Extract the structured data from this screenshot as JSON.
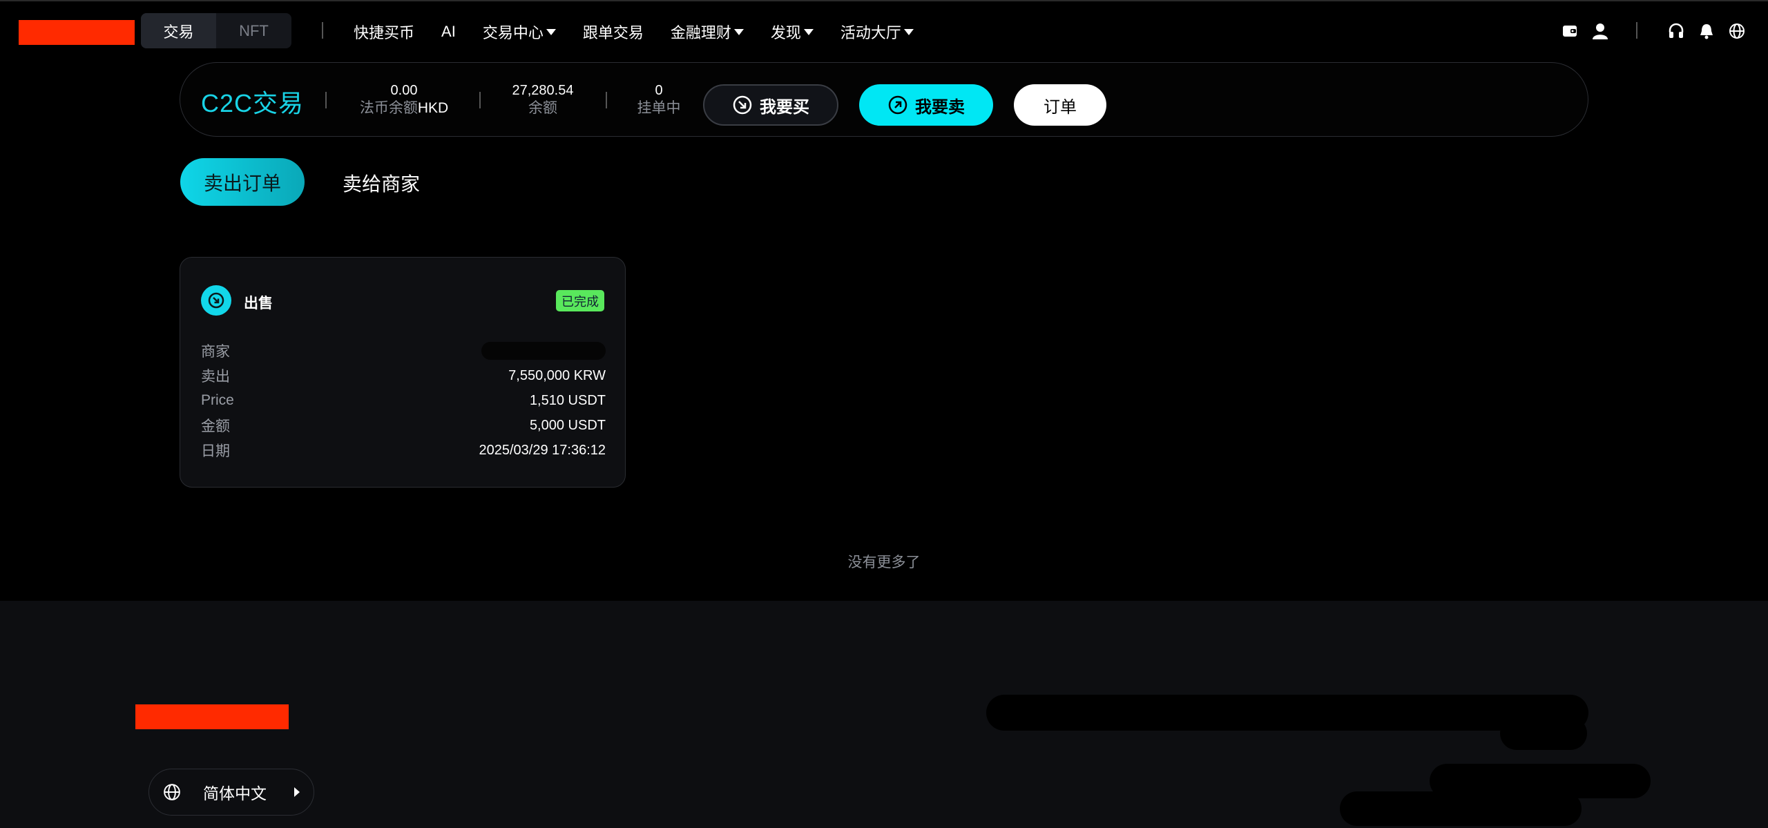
{
  "topbar": {
    "segments": [
      {
        "label": "交易",
        "active": true
      },
      {
        "label": "NFT",
        "active": false
      }
    ],
    "nav": [
      {
        "label": "快捷买币",
        "dropdown": false
      },
      {
        "label": "AI",
        "dropdown": false
      },
      {
        "label": "交易中心",
        "dropdown": true
      },
      {
        "label": "跟单交易",
        "dropdown": false
      },
      {
        "label": "金融理财",
        "dropdown": true
      },
      {
        "label": "发现",
        "dropdown": true
      },
      {
        "label": "活动大厅",
        "dropdown": true
      }
    ],
    "icons": [
      "wallet-icon",
      "user-icon",
      "headset-icon",
      "bell-icon",
      "globe-icon"
    ]
  },
  "c2c": {
    "title": "C2C交易",
    "stats": [
      {
        "value": "0.00",
        "label": "法币余额",
        "unit": "HKD"
      },
      {
        "value": "27,280.54",
        "label": "余额"
      },
      {
        "value": "0",
        "label": "挂单中"
      }
    ],
    "buy_label": "我要买",
    "sell_label": "我要卖",
    "order_label": "订单"
  },
  "tabs": {
    "active": "卖出订单",
    "other": "卖给商家"
  },
  "card": {
    "type": "出售",
    "status": "已完成",
    "rows": [
      {
        "key": "商家",
        "value": ""
      },
      {
        "key": "卖出",
        "value": "7,550,000 KRW"
      },
      {
        "key": "Price",
        "value": "1,510 USDT"
      },
      {
        "key": "金额",
        "value": "5,000 USDT"
      },
      {
        "key": "日期",
        "value": "2025/03/29 17:36:12"
      }
    ]
  },
  "list_end": "没有更多了",
  "footer": {
    "language": "简体中文"
  },
  "colors": {
    "accent": "#00e7f4",
    "status_green": "#59e85c",
    "redaction": "#ff2a00"
  }
}
